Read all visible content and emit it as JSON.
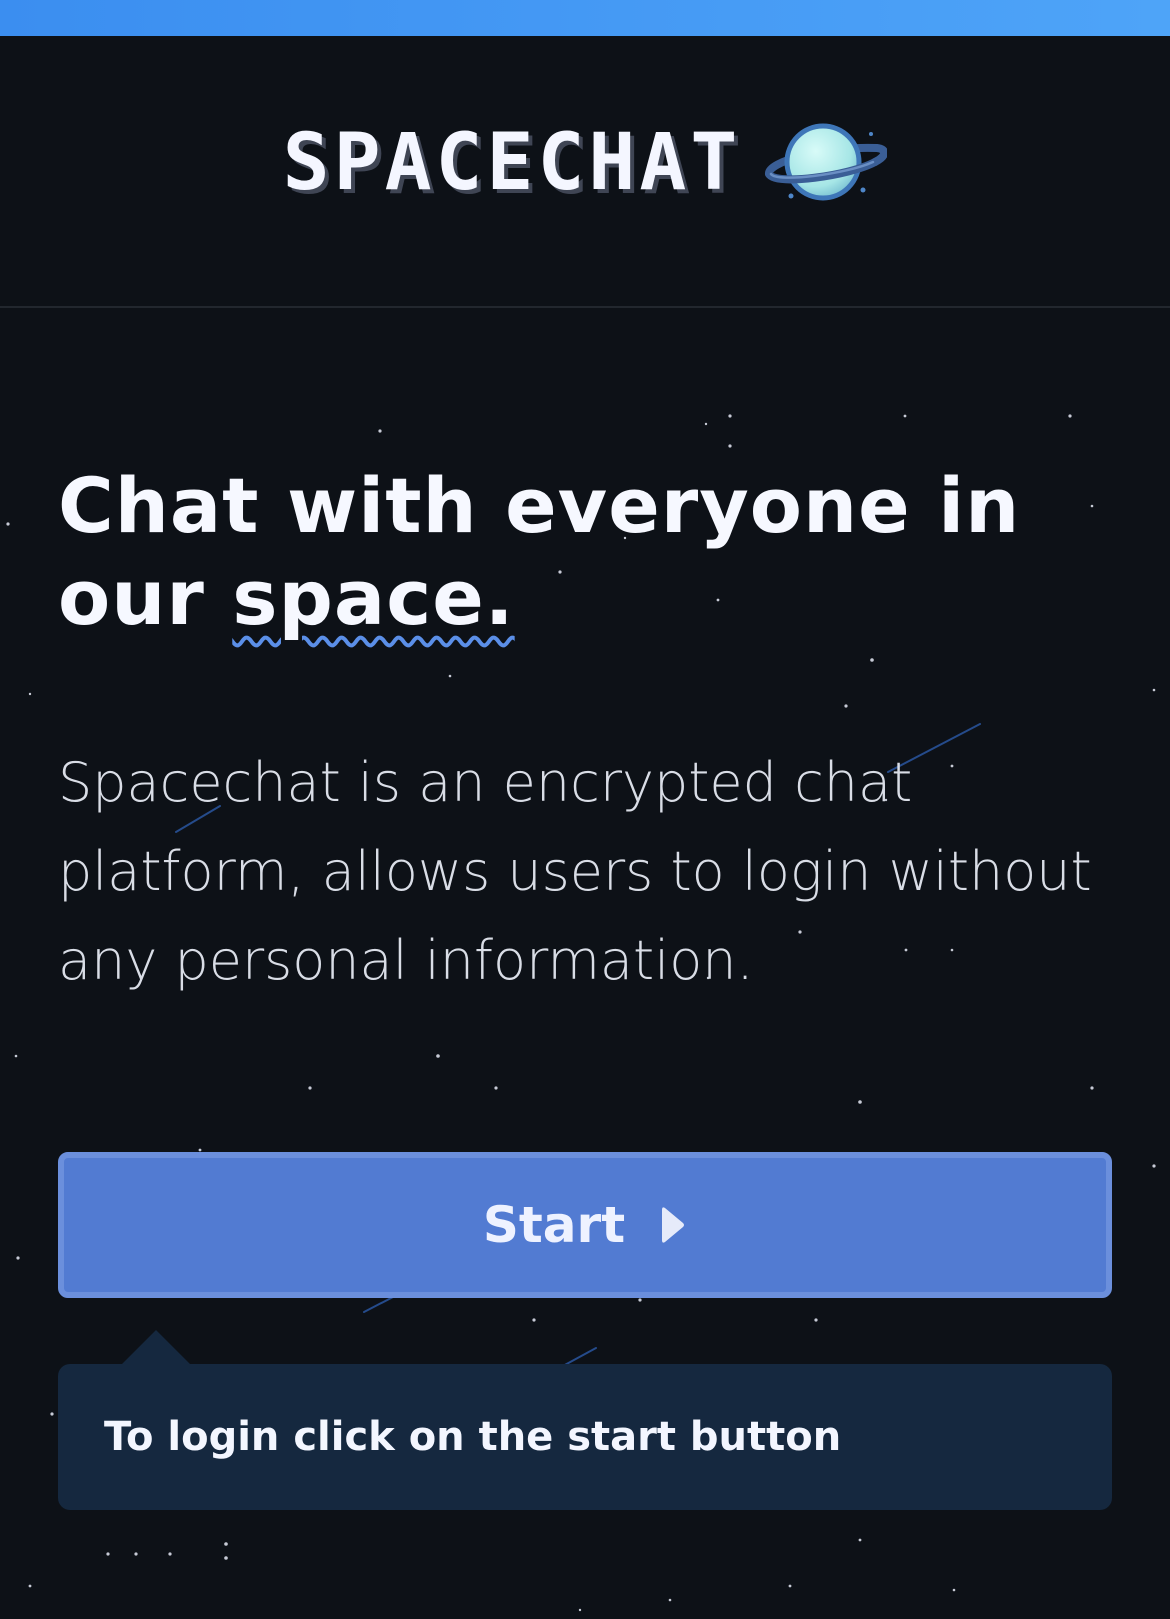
{
  "header": {
    "brand": "SPACECHAT",
    "logo_icon": "planet-icon"
  },
  "hero": {
    "headline_part1": "Chat with everyone in our ",
    "headline_highlight": "space.",
    "description": "Spacechat is an encrypted chat platform, allows users to login without any personal information."
  },
  "start_button": {
    "label": "Start",
    "icon": "play-icon"
  },
  "tooltip": {
    "text": "To login click on the start button"
  },
  "colors": {
    "background": "#0d1117",
    "top_strip": "#3b8ef0",
    "button": "#527bd2",
    "tooltip": "#15283f",
    "accent_underline": "#5b8fe8"
  }
}
